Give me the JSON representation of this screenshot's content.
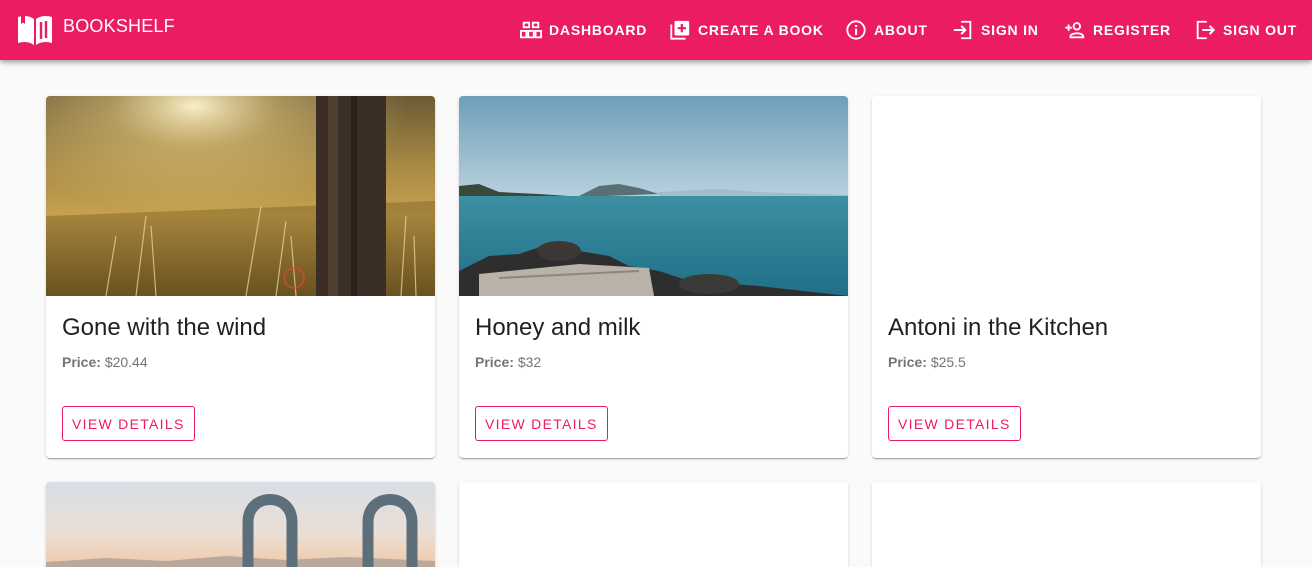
{
  "app": {
    "brand": "BOOKSHELF",
    "accent_color": "#ec1c63",
    "brand_icon": "open-book-icon"
  },
  "nav": [
    {
      "label": "DASHBOARD",
      "icon": "dashboard-icon"
    },
    {
      "label": "CREATE A BOOK",
      "icon": "add-box-icon"
    },
    {
      "label": "ABOUT",
      "icon": "info-icon"
    },
    {
      "label": "SIGN IN",
      "icon": "sign-in-icon"
    },
    {
      "label": "REGISTER",
      "icon": "person-add-icon"
    },
    {
      "label": "SIGN OUT",
      "icon": "sign-out-icon"
    }
  ],
  "books": [
    {
      "title": "Gone with the wind",
      "price_label": "Price:",
      "price": "$20.44",
      "button": "VIEW DETAILS"
    },
    {
      "title": "Honey and milk",
      "price_label": "Price:",
      "price": "$32",
      "button": "VIEW DETAILS"
    },
    {
      "title": "Antoni in the Kitchen",
      "price_label": "Price:",
      "price": "$25.5",
      "button": "VIEW DETAILS"
    }
  ]
}
